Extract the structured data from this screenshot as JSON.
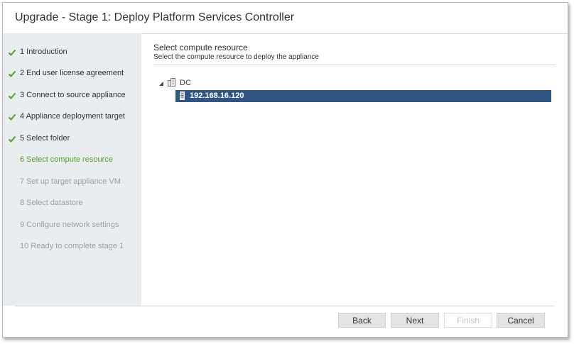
{
  "window": {
    "title": "Upgrade - Stage 1: Deploy Platform Services Controller"
  },
  "steps": [
    {
      "label": "1 Introduction",
      "state": "done"
    },
    {
      "label": "2 End user license agreement",
      "state": "done"
    },
    {
      "label": "3 Connect to source appliance",
      "state": "done"
    },
    {
      "label": "4 Appliance deployment target",
      "state": "done"
    },
    {
      "label": "5 Select folder",
      "state": "done"
    },
    {
      "label": "6 Select compute resource",
      "state": "current"
    },
    {
      "label": "7 Set up target appliance VM",
      "state": "future"
    },
    {
      "label": "8 Select datastore",
      "state": "future"
    },
    {
      "label": "9 Configure network settings",
      "state": "future"
    },
    {
      "label": "10 Ready to complete stage 1",
      "state": "future"
    }
  ],
  "content": {
    "title": "Select compute resource",
    "subtitle": "Select the compute resource to deploy the appliance"
  },
  "tree": {
    "root": {
      "label": "DC",
      "icon": "datacenter-icon",
      "expanded": true
    },
    "selected_child": {
      "label": "192.168.16.120",
      "icon": "host-icon",
      "selected": true
    }
  },
  "buttons": {
    "back": "Back",
    "next": "Next",
    "finish": "Finish",
    "cancel": "Cancel"
  },
  "colors": {
    "check_green": "#53a023",
    "current_step": "#53a023",
    "selection": "#2e5583",
    "sidebar_bg": "#eaedf0"
  }
}
